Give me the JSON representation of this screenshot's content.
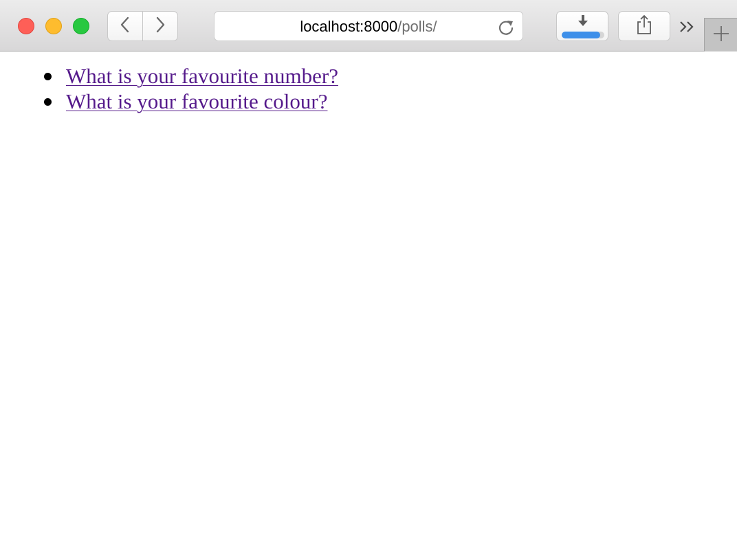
{
  "browser": {
    "address_bar": {
      "host": "localhost:8000",
      "path": "/polls/"
    },
    "icons": {
      "back": "chevron-left-icon",
      "forward": "chevron-right-icon",
      "reload": "reload-icon",
      "downloads": "download-arrow-icon",
      "share": "share-icon",
      "overflow": "double-chevron-right-icon",
      "new_tab": "plus-icon"
    },
    "download_progress": 0.9,
    "colors": {
      "close": "#fe5f57",
      "minimize": "#febc2e",
      "zoom": "#28c840",
      "progress": "#3d8fe9",
      "visited_link": "#551a8b"
    }
  },
  "polls": {
    "items": [
      {
        "label": "What is your favourite number?"
      },
      {
        "label": "What is your favourite colour?"
      }
    ]
  }
}
